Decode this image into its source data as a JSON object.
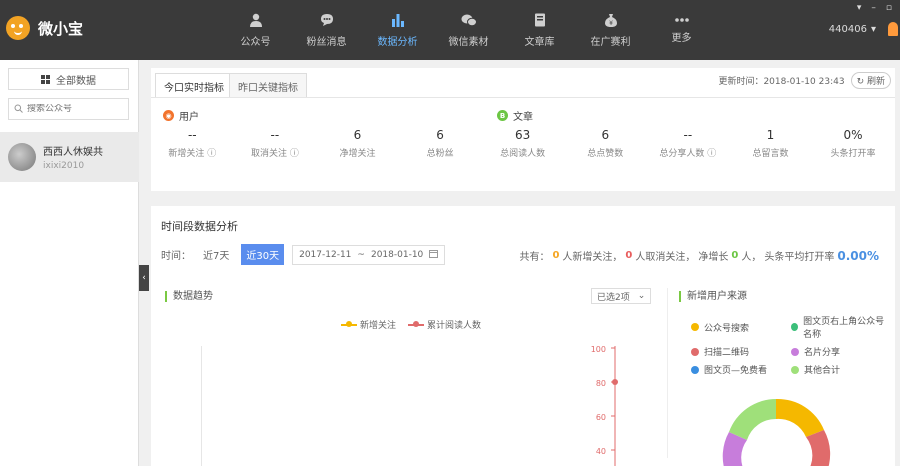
{
  "app": {
    "name": "微小宝"
  },
  "nav": [
    {
      "label": "公众号",
      "icon": "user-icon",
      "active": false
    },
    {
      "label": "粉丝消息",
      "icon": "chat-icon",
      "active": false
    },
    {
      "label": "数据分析",
      "icon": "bar-chart-icon",
      "active": true
    },
    {
      "label": "微信素材",
      "icon": "wechat-icon",
      "active": false
    },
    {
      "label": "文章库",
      "icon": "book-icon",
      "active": false
    },
    {
      "label": "在广赛利",
      "icon": "money-bag-icon",
      "active": false
    },
    {
      "label": "更多",
      "icon": "more-dots-icon",
      "active": false
    }
  ],
  "account": {
    "id": "440406"
  },
  "window": {
    "controls": [
      "▾",
      "–",
      "▫"
    ]
  },
  "sidebar": {
    "all_label": "全部数据",
    "search_placeholder": "搜索公众号",
    "accounts": [
      {
        "name": "西西人休娱共",
        "id": "ixixi2010"
      }
    ]
  },
  "realtime": {
    "tabs": [
      "今口实时指标",
      "昨口关键指标"
    ],
    "update_label": "更新时间：2018-01-10 23:43",
    "refresh_label": "刷新",
    "sections": {
      "user": "用户",
      "article": "文章"
    },
    "metrics": [
      {
        "value": "--",
        "label": "新增关注 ⓘ"
      },
      {
        "value": "--",
        "label": "取消关注 ⓘ"
      },
      {
        "value": "6",
        "label": "净增关注"
      },
      {
        "value": "6",
        "label": "总粉丝"
      },
      {
        "value": "63",
        "label": "总阅读人数"
      },
      {
        "value": "6",
        "label": "总点赞数"
      },
      {
        "value": "--",
        "label": "总分享人数 ⓘ"
      },
      {
        "value": "1",
        "label": "总留言数"
      },
      {
        "value": "0%",
        "label": "头条打开率"
      }
    ]
  },
  "period": {
    "title": "时间段数据分析",
    "time_label": "时间：",
    "btn_7": "近7天",
    "btn_30": "近30天",
    "date_start": "2017-12-11",
    "date_sep": "~",
    "date_end": "2018-01-10",
    "summary": {
      "prefix": "共有：",
      "new_follow": "0",
      "new_follow_label": "人新增关注，",
      "unfollow": "0",
      "unfollow_label": "人取消关注，",
      "net_label": "净增长",
      "net": "0",
      "net_suffix": "人，",
      "rate_label": "头条平均打开率",
      "rate": "0.00%"
    }
  },
  "trend": {
    "title": "数据趋势",
    "range_select": "已选2项",
    "legend": [
      "新增关注",
      "累计阅读人数"
    ]
  },
  "source": {
    "title": "新增用户来源",
    "items": [
      {
        "label": "公众号搜索",
        "color": "#f5b800"
      },
      {
        "label": "图文页右上角公众号名称",
        "color": "#3cbf7a"
      },
      {
        "label": "扫描二维码",
        "color": "#e06b6b"
      },
      {
        "label": "名片分享",
        "color": "#c77ddb"
      },
      {
        "label": "图文页—免费看",
        "color": "#3a8ee0"
      },
      {
        "label": "其他合计",
        "color": "#9fe07a"
      }
    ]
  },
  "chart_data": {
    "type": "line",
    "series": [
      {
        "name": "新增关注",
        "color": "#f5b800"
      },
      {
        "name": "累计阅读人数",
        "color": "#e06b6b"
      }
    ],
    "y_right_ticks": [
      100,
      80,
      60,
      40
    ],
    "ylim": [
      0,
      100
    ]
  }
}
